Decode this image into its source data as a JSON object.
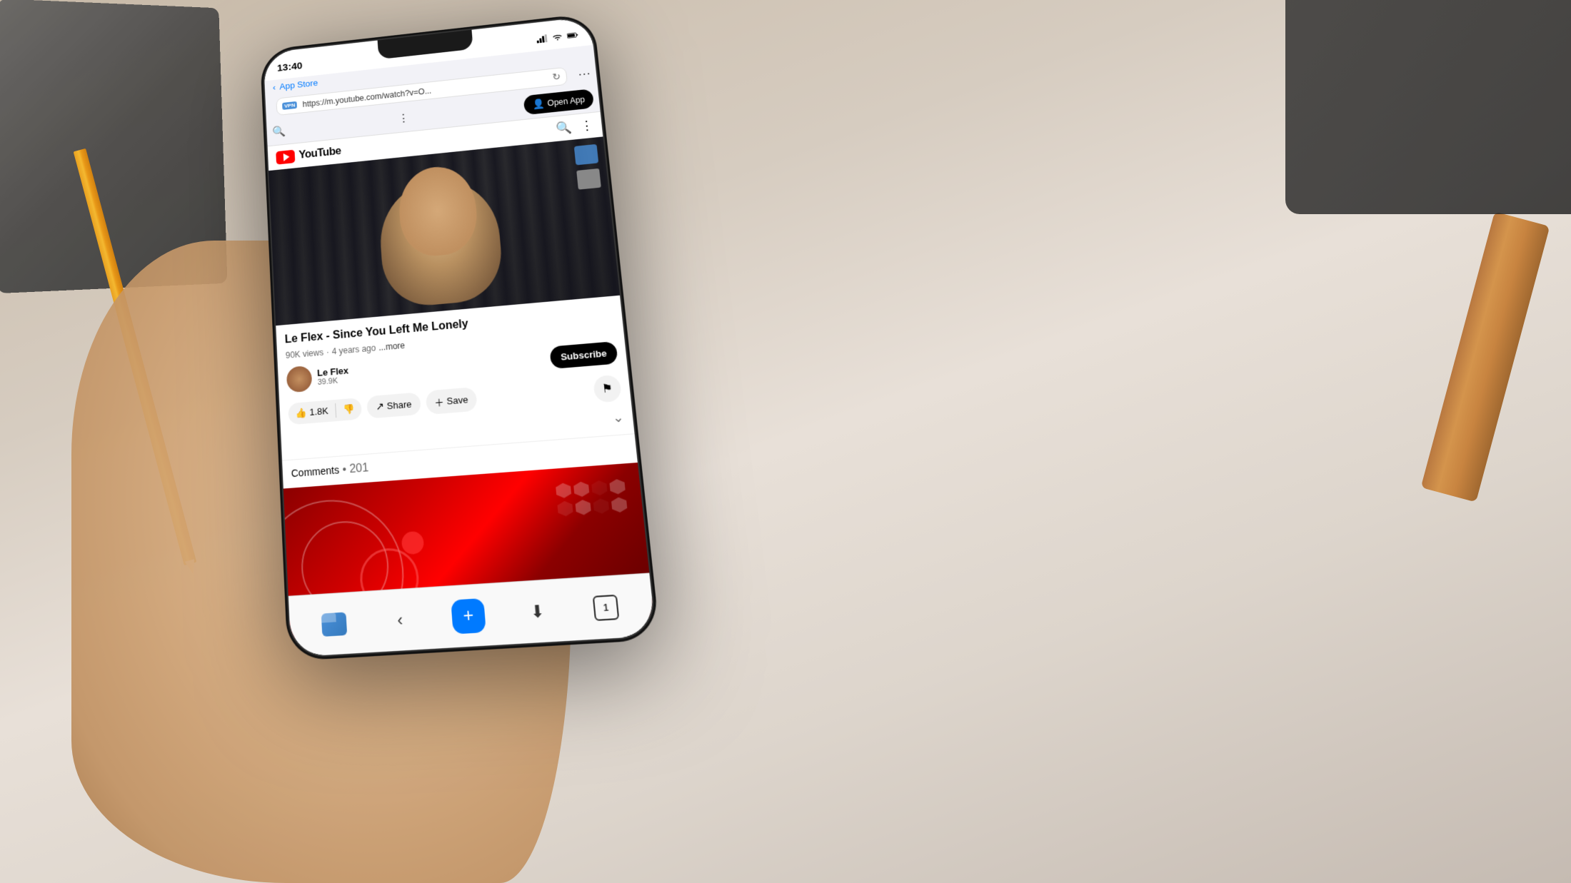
{
  "background": {
    "color": "#d4c5b0"
  },
  "phone": {
    "status_bar": {
      "time": "13:40",
      "signal": "signal-icon",
      "wifi": "wifi-icon",
      "battery": "battery-icon"
    },
    "browser": {
      "back_label": "App Store",
      "url": "https://m.youtube.com/watch?v=O...",
      "vpn_label": "VPN",
      "reload_icon": "reload-icon",
      "more_icon": "more-icon",
      "open_app_label": "Open App",
      "search_icon": "search-icon",
      "menu_icon": "menu-icon"
    },
    "youtube": {
      "logo_text": "YouTube",
      "video": {
        "title": "Le Flex - Since You Left Me Lonely",
        "views": "90K views",
        "age": "4 years ago",
        "more_label": "...more",
        "likes": "1.8K",
        "share_label": "Share",
        "save_label": "Save"
      },
      "channel": {
        "name": "Le Flex",
        "subscribers": "39.9K",
        "subscribe_label": "Subscribe"
      },
      "comments": {
        "label": "Comments",
        "count": "201"
      }
    },
    "browser_bottom": {
      "back_icon": "back-icon",
      "download_icon": "download-icon",
      "new_tab_icon": "new-tab-icon",
      "tab_count": "1"
    }
  }
}
